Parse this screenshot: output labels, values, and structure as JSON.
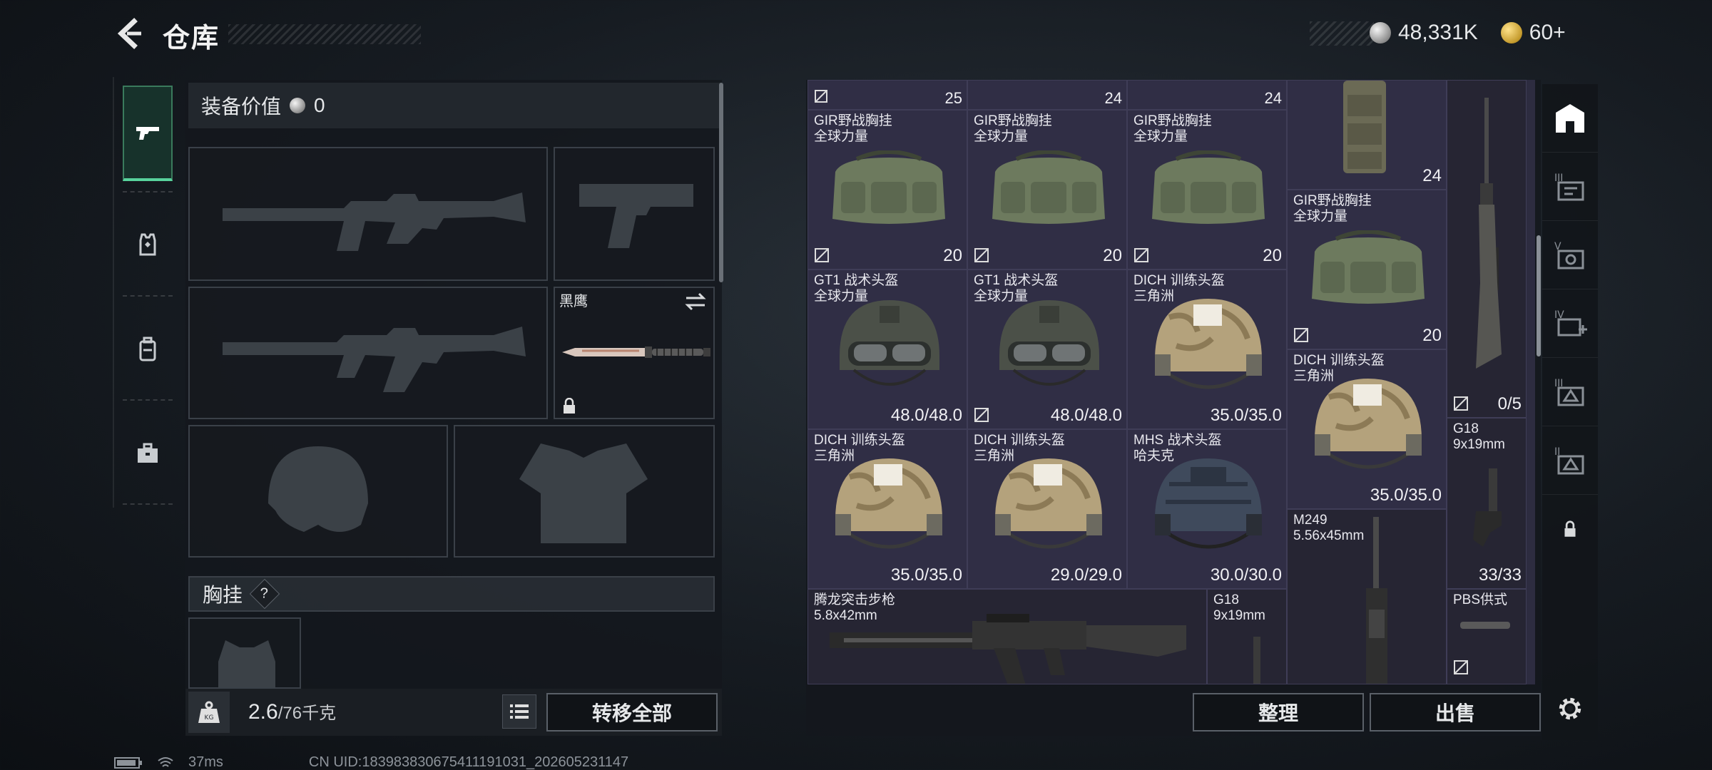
{
  "header": {
    "title": "仓库"
  },
  "currency": {
    "silver": "48,331K",
    "gold": "60+"
  },
  "equip": {
    "value_label": "装备价值",
    "value": "0",
    "knife_name": "黑鹰",
    "chest_section": "胸挂",
    "help": "?"
  },
  "weight": {
    "current": "2.6",
    "max": "/76",
    "unit": "千克"
  },
  "buttons": {
    "transfer_all": "转移全部",
    "sort": "整理",
    "sell": "出售"
  },
  "status": {
    "ping": "37ms",
    "uid": "CN UID:183983830675411191031_202605231147"
  },
  "grid": {
    "top_partial": [
      "25",
      "24",
      "24"
    ],
    "tall_bag_count": "24",
    "row1": [
      {
        "name1": "GIR野战胸挂",
        "name2": "全球力量",
        "value": "20"
      },
      {
        "name1": "GIR野战胸挂",
        "name2": "全球力量",
        "value": "20"
      },
      {
        "name1": "GIR野战胸挂",
        "name2": "全球力量",
        "value": "20"
      }
    ],
    "bag4": {
      "name1": "GIR野战胸挂",
      "name2": "全球力量",
      "value": "20"
    },
    "row2": [
      {
        "name1": "GT1 战术头盔",
        "name2": "全球力量",
        "value": "48.0/48.0"
      },
      {
        "name1": "GT1 战术头盔",
        "name2": "全球力量",
        "value": "48.0/48.0"
      },
      {
        "name1": "DICH 训练头盔",
        "name2": "三角洲",
        "value": "35.0/35.0"
      }
    ],
    "helmet4": {
      "name1": "DICH 训练头盔",
      "name2": "三角洲",
      "value": "35.0/35.0"
    },
    "rifle_count": "0/5",
    "row3": [
      {
        "name1": "DICH 训练头盔",
        "name2": "三角洲",
        "value": "35.0/35.0"
      },
      {
        "name1": "DICH 训练头盔",
        "name2": "三角洲",
        "value": "29.0/29.0"
      },
      {
        "name1": "MHS 战术头盔",
        "name2": "哈夫克",
        "value": "30.0/30.0"
      }
    ],
    "g18_right": {
      "name1": "G18",
      "name2": "9x19mm",
      "value": "33/33"
    },
    "m249": {
      "name1": "M249",
      "name2": "5.56x45mm"
    },
    "row4": {
      "rifle": {
        "name1": "腾龙突击步枪",
        "name2": "5.8x42mm"
      },
      "g18": {
        "name1": "G18",
        "name2": "9x19mm"
      },
      "pbs": {
        "name1": "PBS供式"
      }
    }
  },
  "colors": {
    "accent_green": "#58d39c",
    "grid_bg": "#302e45"
  }
}
